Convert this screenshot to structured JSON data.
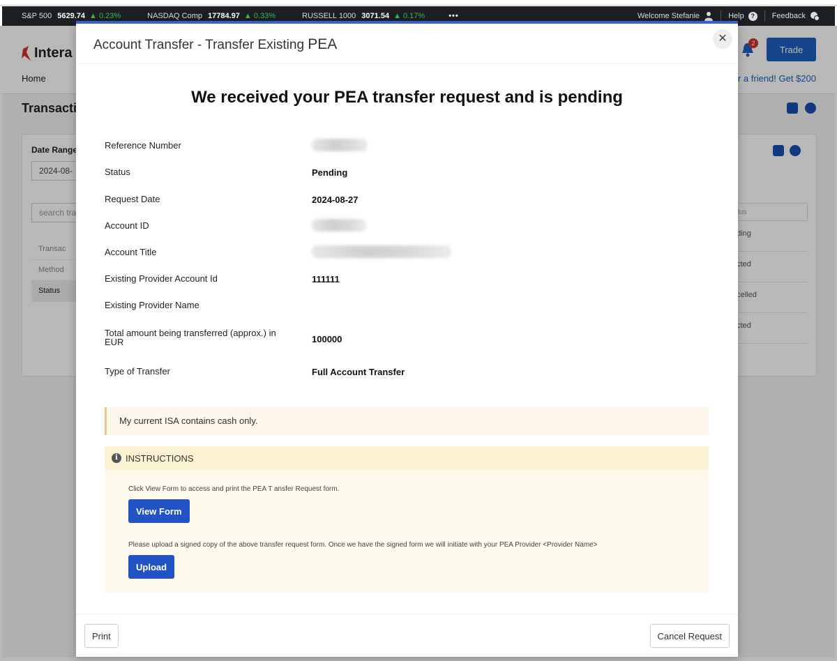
{
  "ticker": {
    "items": [
      {
        "name": "S&P 500",
        "value": "5629.74",
        "change": "▲ 0.23%"
      },
      {
        "name": "NASDAQ Comp",
        "value": "17784.97",
        "change": "▲ 0.33%"
      },
      {
        "name": "RUSSELL 1000",
        "value": "3071.54",
        "change": "▲ 0.17%"
      }
    ],
    "more": "•••",
    "welcome": "Welcome Stefanie",
    "help": "Help",
    "feedback": "Feedback"
  },
  "background": {
    "logo": "Intera",
    "home": "Home",
    "refer": "r a friend! Get $200",
    "trade": "Trade",
    "notifications": "2",
    "page_title": "Transacti",
    "date_range_label": "Date Range",
    "date_value": "2024-08-",
    "search_placeholder": "search tra",
    "filters": [
      "Transac",
      "Method",
      "Status"
    ],
    "status_header": "tus",
    "status_cells": [
      "nding",
      "ected",
      "ncelled",
      "ected"
    ]
  },
  "modal": {
    "title": "Account Transfer - Transfer Existing ",
    "title_pea": "PEA",
    "headline_prefix": "We received your ",
    "headline_pea": "PEA",
    "headline_suffix": " transfer request and is pending",
    "fields": {
      "reference_label": "Reference Number",
      "status_label": "Status",
      "status_value": "Pending",
      "request_date_label": "Request Date",
      "request_date_value": "2024-08-27",
      "account_id_label": "Account ID",
      "account_title_label": "Account Title",
      "provider_account_label": "Existing Provider Account Id",
      "provider_account_value": "111111",
      "provider_name_label": "Existing Provider Name",
      "total_label": "Total amount being transferred (approx.) in EUR",
      "total_value": "100000",
      "type_label": "Type of Transfer",
      "type_value": "Full Account Transfer"
    },
    "notice": "My current ISA contains cash only.",
    "instructions": {
      "heading": "INSTRUCTIONS",
      "text1": "Click View Form to access and print the PEA T ansfer Request form.",
      "view_form": "View Form",
      "text2": "Please upload a signed copy of the above transfer request form. Once we have the signed form we will initiate with your PEA Provider <Provider Name>",
      "upload": "Upload"
    },
    "footer": {
      "print": "Print",
      "cancel": "Cancel Request"
    }
  },
  "colors": {
    "accent": "#2253c4",
    "ticker_bg": "#1c1f24",
    "positive": "#3fb950",
    "notice_bg": "#fdf6ea",
    "instructions_bg": "#fdf9ec"
  }
}
